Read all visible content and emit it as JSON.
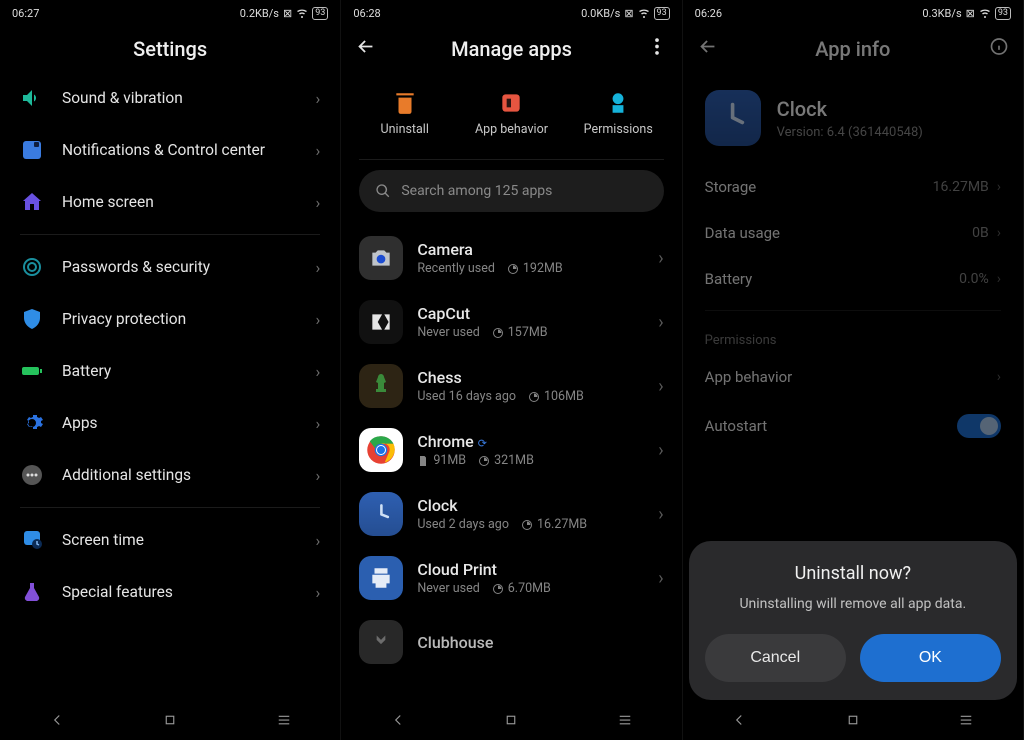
{
  "panel1": {
    "status": {
      "time": "06:27",
      "net": "0.2KB/s",
      "batt": "93"
    },
    "title": "Settings",
    "items": [
      {
        "label": "Sound & vibration",
        "icon": "sound"
      },
      {
        "label": "Notifications & Control center",
        "icon": "notif"
      },
      {
        "label": "Home screen",
        "icon": "home"
      },
      {
        "_div": true
      },
      {
        "label": "Passwords & security",
        "icon": "shield"
      },
      {
        "label": "Privacy protection",
        "icon": "privacy"
      },
      {
        "label": "Battery",
        "icon": "battery"
      },
      {
        "label": "Apps",
        "icon": "apps"
      },
      {
        "label": "Additional settings",
        "icon": "dots"
      },
      {
        "_div": true
      },
      {
        "label": "Screen time",
        "icon": "time"
      },
      {
        "label": "Special features",
        "icon": "special"
      }
    ]
  },
  "panel2": {
    "status": {
      "time": "06:28",
      "net": "0.0KB/s",
      "batt": "93"
    },
    "title": "Manage apps",
    "actions": {
      "uninstall": "Uninstall",
      "behavior": "App behavior",
      "permissions": "Permissions"
    },
    "search_placeholder": "Search among 125 apps",
    "apps": [
      {
        "name": "Camera",
        "sub": "Recently used",
        "size": "192MB",
        "ic": "camera"
      },
      {
        "name": "CapCut",
        "sub": "Never used",
        "size": "157MB",
        "ic": "capcut"
      },
      {
        "name": "Chess",
        "sub": "Used 16 days ago",
        "size": "106MB",
        "ic": "chess"
      },
      {
        "name": "Chrome",
        "sub": "",
        "size": "321MB",
        "ic": "chrome",
        "alt_size": "91MB"
      },
      {
        "name": "Clock",
        "sub": "Used 2 days ago",
        "size": "16.27MB",
        "ic": "clock"
      },
      {
        "name": "Cloud Print",
        "sub": "Never used",
        "size": "6.70MB",
        "ic": "cloud"
      },
      {
        "name": "Clubhouse",
        "sub": "",
        "size": "",
        "ic": "club"
      }
    ]
  },
  "panel3": {
    "status": {
      "time": "06:26",
      "net": "0.3KB/s",
      "batt": "93"
    },
    "title": "App info",
    "app_name": "Clock",
    "app_version": "Version: 6.4 (361440548)",
    "rows": {
      "storage": {
        "label": "Storage",
        "value": "16.27MB"
      },
      "data_usage": {
        "label": "Data usage",
        "value": "0B"
      },
      "battery": {
        "label": "Battery",
        "value": "0.0%"
      }
    },
    "perm_header": "Permissions",
    "behavior_label": "App behavior",
    "autostart_label": "Autostart",
    "sheet": {
      "title": "Uninstall now?",
      "msg": "Uninstalling will remove all app data.",
      "cancel": "Cancel",
      "ok": "OK"
    }
  }
}
